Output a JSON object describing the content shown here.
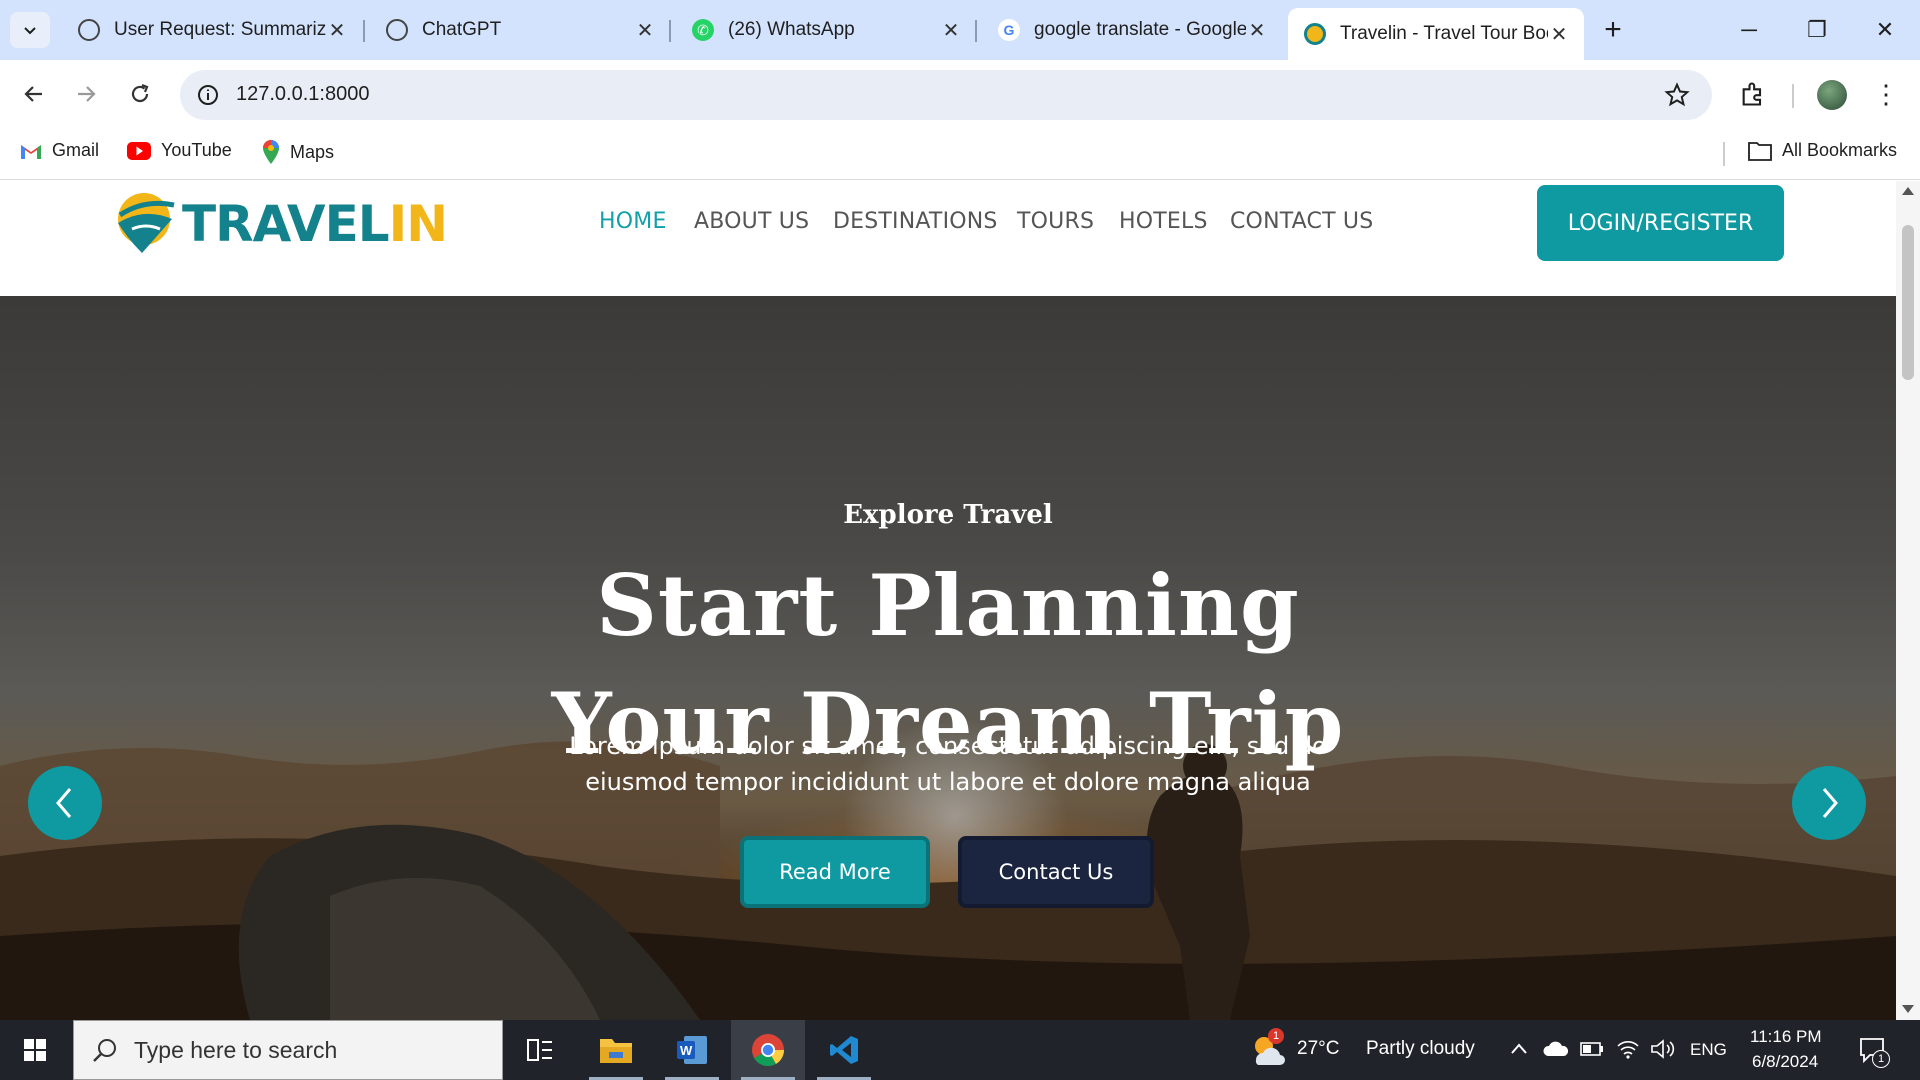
{
  "browser": {
    "tabs": [
      {
        "title": "User Request: Summarize",
        "icon": "openai-icon"
      },
      {
        "title": "ChatGPT",
        "icon": "openai-icon"
      },
      {
        "title": "(26) WhatsApp",
        "icon": "whatsapp-icon"
      },
      {
        "title": "google translate - Google",
        "icon": "google-icon"
      },
      {
        "title": "Travelin - Travel Tour Boo",
        "icon": "travelin-icon",
        "active": true
      }
    ],
    "url": "127.0.0.1:8000",
    "bookmarks": [
      {
        "label": "Gmail"
      },
      {
        "label": "YouTube"
      },
      {
        "label": "Maps"
      }
    ],
    "all_bookmarks": "All Bookmarks"
  },
  "site": {
    "logo": {
      "part1": "TRAVEL",
      "part2": "IN"
    },
    "nav": [
      "HOME",
      "ABOUT US",
      "DESTINATIONS",
      "TOURS",
      "HOTELS",
      "CONTACT US"
    ],
    "login": "LOGIN/REGISTER",
    "hero": {
      "eyebrow": "Explore Travel",
      "title_line1": "Start Planning",
      "title_line2": "Your Dream Trip",
      "subtitle_line1": "Lorem ipsum dolor sit amet, consectetur adipiscing elit, sed do",
      "subtitle_line2": "eiusmod tempor incididunt ut labore et dolore magna aliqua",
      "read_more": "Read More",
      "contact_us": "Contact Us"
    },
    "colors": {
      "teal": "#0f9aa1",
      "navy": "#1b2540",
      "yellow": "#f2b619"
    }
  },
  "taskbar": {
    "search_placeholder": "Type here to search",
    "weather": {
      "temp": "27°C",
      "condition": "Partly cloudy",
      "badge": "1"
    },
    "language": "ENG",
    "time": "11:16 PM",
    "date": "6/8/2024",
    "notification_count": "1"
  }
}
